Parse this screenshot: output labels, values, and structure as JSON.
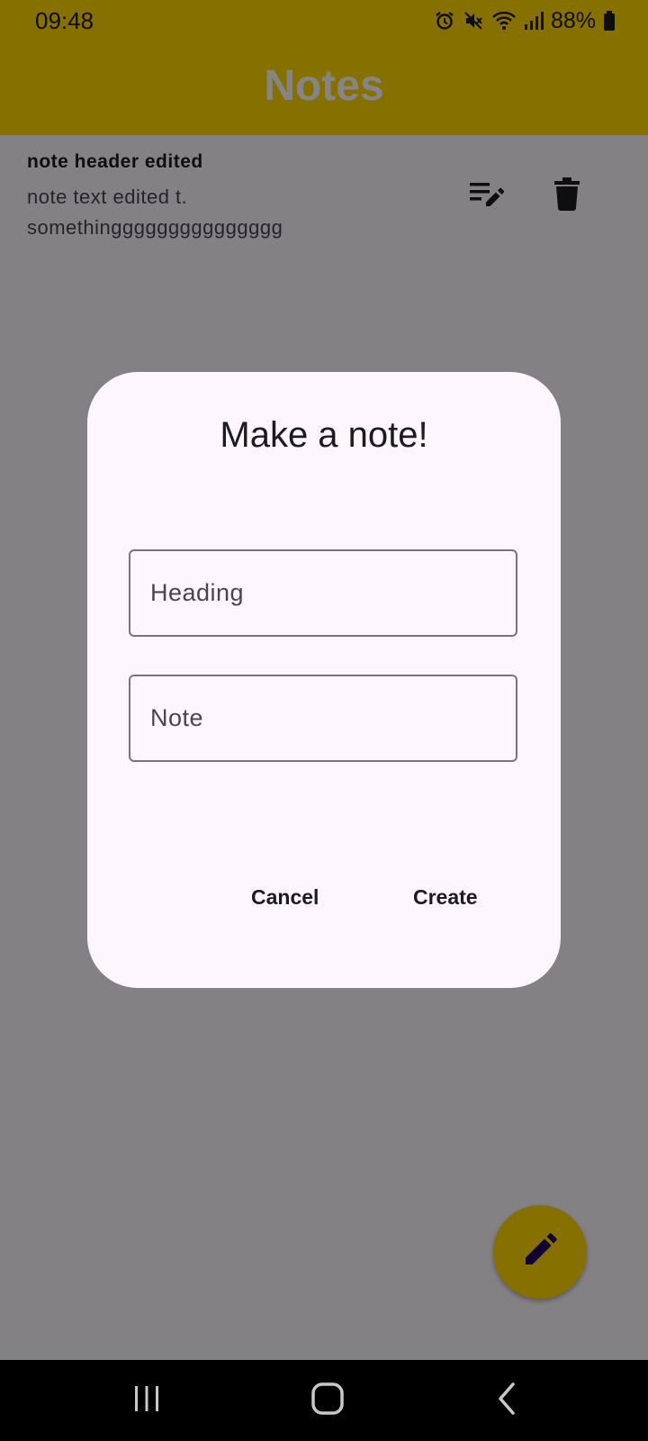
{
  "status_bar": {
    "time": "09:48",
    "battery": "88%",
    "icons": [
      "alarm-icon",
      "mute-icon",
      "wifi-icon",
      "signal-icon",
      "battery-icon"
    ]
  },
  "app_bar": {
    "title": "Notes"
  },
  "notes": [
    {
      "header": "note header edited",
      "body": "note text edited t.\nsomethinggggggggggggggg",
      "actions": [
        "edit-note-icon",
        "delete-icon"
      ]
    }
  ],
  "dialog": {
    "title": "Make a note!",
    "heading_field": {
      "placeholder": "Heading",
      "value": ""
    },
    "note_field": {
      "placeholder": "Note",
      "value": ""
    },
    "cancel_label": "Cancel",
    "create_label": "Create"
  },
  "fab": {
    "icon": "pencil-icon"
  },
  "nav_bar": {
    "buttons": [
      "recents-icon",
      "home-icon",
      "back-icon"
    ]
  },
  "colors": {
    "app_bar": "#ffd700",
    "fab": "#ffd700",
    "dialog_surface": "#fdf7fd",
    "scrim": "#000000",
    "nav_bar": "#000000"
  }
}
